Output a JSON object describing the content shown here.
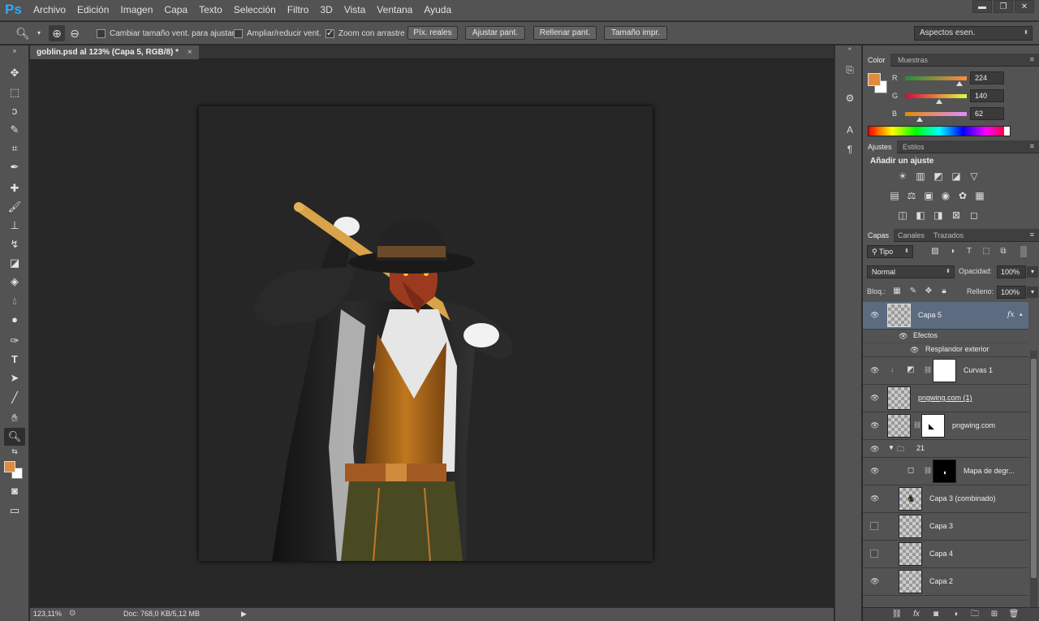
{
  "app": {
    "logo": "Ps"
  },
  "menu": [
    "Archivo",
    "Edición",
    "Imagen",
    "Capa",
    "Texto",
    "Selección",
    "Filtro",
    "3D",
    "Vista",
    "Ventana",
    "Ayuda"
  ],
  "window_controls": {
    "minimize": "▬",
    "restore": "❐",
    "close": "✕"
  },
  "options_bar": {
    "resize_windows": {
      "label": "Cambiar tamaño vent. para ajustar",
      "checked": false
    },
    "zoom_all": {
      "label": "Ampliar/reducir vent.",
      "checked": false
    },
    "scrubby_zoom": {
      "label": "Zoom con arrastre",
      "checked": true
    },
    "buttons": [
      "Píx. reales",
      "Ajustar pant.",
      "Rellenar pant.",
      "Tamaño impr."
    ],
    "workspace": "Aspectos esen."
  },
  "document": {
    "tab_title": "goblin.psd al 123% (Capa 5, RGB/8) *",
    "close": "×"
  },
  "status": {
    "zoom": "123,11%",
    "doc_size": "Doc: 768,0 KB/5,12 MB"
  },
  "colors": {
    "foreground": "#e08c3e",
    "background": "#ffffff",
    "selected_layer": "#5d6b80"
  },
  "color_panel": {
    "tabs": [
      "Color",
      "Muestras"
    ],
    "channels": [
      {
        "label": "R",
        "value": "224",
        "fraction": 0.88
      },
      {
        "label": "G",
        "value": "140",
        "fraction": 0.55
      },
      {
        "label": "B",
        "value": "62",
        "fraction": 0.24
      }
    ]
  },
  "adjustments_panel": {
    "tabs": [
      "Ajustes",
      "Estilos"
    ],
    "heading": "Añadir un ajuste"
  },
  "layers_panel": {
    "tabs": [
      "Capas",
      "Canales",
      "Trazados"
    ],
    "filter": "Tipo",
    "blend_mode": "Normal",
    "opacity_label": "Opacidad:",
    "opacity": "100%",
    "lock_label": "Bloq.:",
    "fill_label": "Relleno:",
    "fill": "100%",
    "fx_label": "fx",
    "effects_label": "Efectos",
    "effect_name": "Resplandor exterior",
    "layers": [
      {
        "name": "Capa 5",
        "visible": true,
        "selected": true
      },
      {
        "name": "Curvas 1",
        "visible": true
      },
      {
        "name": "pngwing.com (1)",
        "visible": true
      },
      {
        "name": "pngwing.com",
        "visible": true
      },
      {
        "name": "21",
        "visible": true
      },
      {
        "name": "Mapa de degr...",
        "visible": true
      },
      {
        "name": "Capa 3 (combinado)",
        "visible": true
      },
      {
        "name": "Capa 3",
        "visible": false
      },
      {
        "name": "Capa 4",
        "visible": false
      },
      {
        "name": "Capa 2",
        "visible": true
      }
    ]
  }
}
